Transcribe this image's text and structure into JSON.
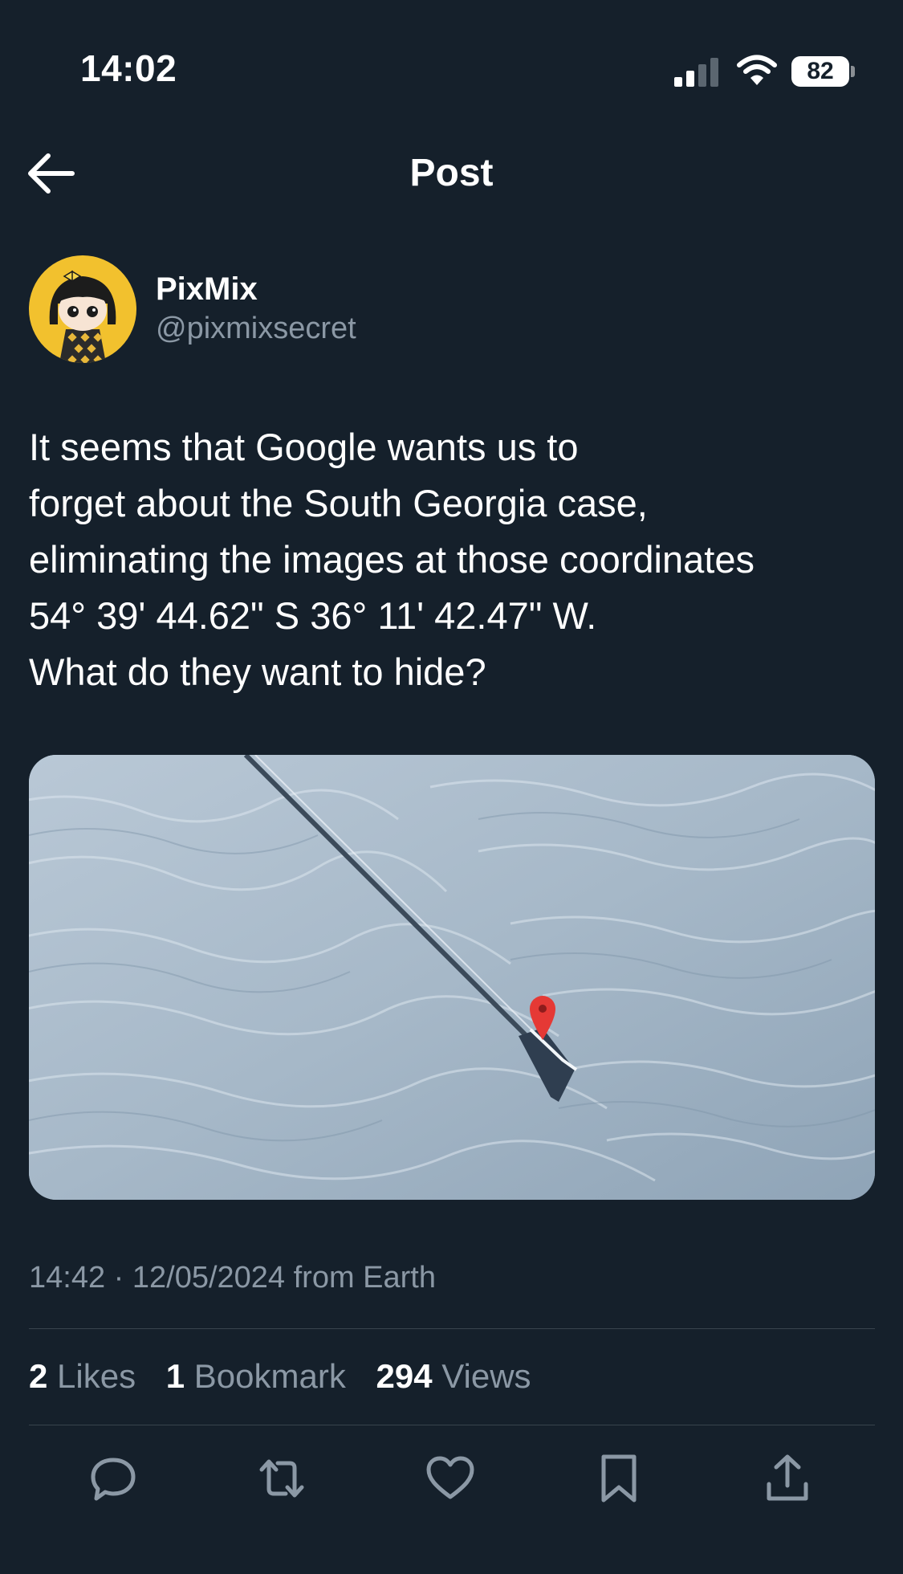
{
  "status_bar": {
    "time": "14:02",
    "battery_level": "82",
    "signal_icon": "cellular-signal-icon",
    "wifi_icon": "wifi-icon"
  },
  "nav": {
    "title": "Post",
    "back_icon": "back-arrow-icon"
  },
  "author": {
    "display_name": "PixMix",
    "handle": "@pixmixsecret"
  },
  "post": {
    "text": "It seems that Google wants us to\nforget about the South Georgia case,\neliminating the images at those coordinates\n54° 39' 44.62\" S 36° 11' 42.47\" W.\nWhat do they want to hide?",
    "timestamp": "14:42 · 12/05/2024 from Earth"
  },
  "stats": {
    "likes_count": "2",
    "likes_label": "Likes",
    "bookmarks_count": "1",
    "bookmarks_label": "Bookmark",
    "views_count": "294",
    "views_label": "Views"
  },
  "actions": [
    "reply-icon",
    "repost-icon",
    "like-icon",
    "bookmark-icon",
    "share-icon"
  ],
  "colors": {
    "background": "#15202b",
    "text_primary": "#ffffff",
    "text_secondary": "#8b98a5",
    "divider": "#38444d",
    "map_pin": "#e53935",
    "avatar_background": "#f2c12e"
  }
}
